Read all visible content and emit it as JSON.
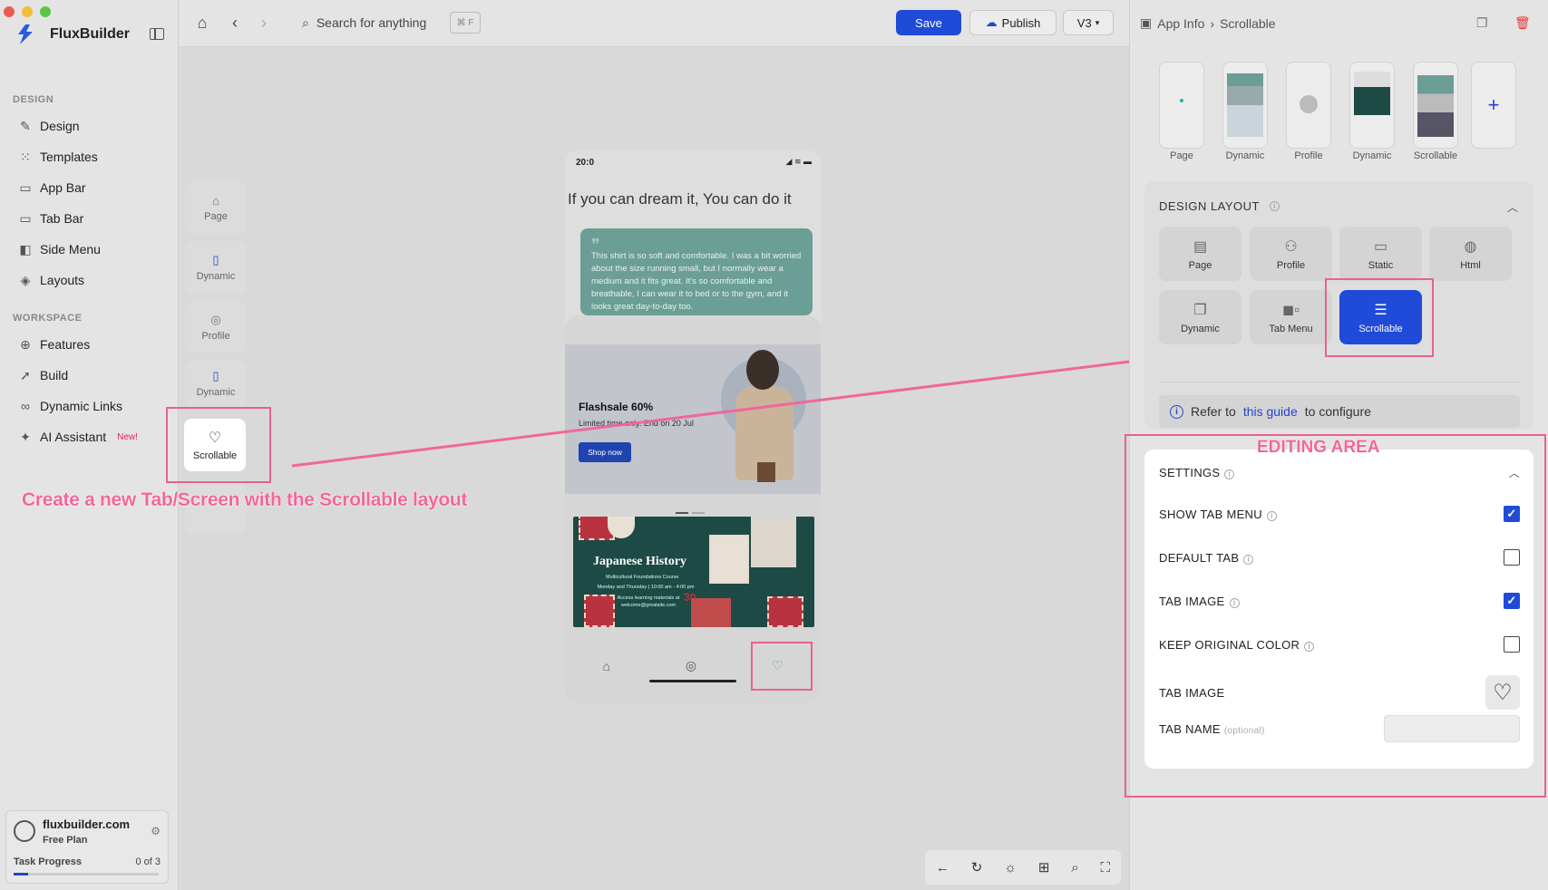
{
  "app": {
    "title": "FluxBuilder"
  },
  "sidebar": {
    "design_label": "DESIGN",
    "design_items": [
      {
        "label": "Design",
        "icon": "pen-icon"
      },
      {
        "label": "Templates",
        "icon": "grid-icon"
      },
      {
        "label": "App Bar",
        "icon": "appbar-icon"
      },
      {
        "label": "Tab Bar",
        "icon": "tabbar-icon"
      },
      {
        "label": "Side Menu",
        "icon": "sidemenu-icon"
      },
      {
        "label": "Layouts",
        "icon": "layers-icon"
      }
    ],
    "workspace_label": "WORKSPACE",
    "workspace_items": [
      {
        "label": "Features",
        "icon": "plus-circle-icon"
      },
      {
        "label": "Build",
        "icon": "rocket-icon"
      },
      {
        "label": "Dynamic Links",
        "icon": "link-icon"
      },
      {
        "label": "AI Assistant",
        "icon": "sparkle-icon",
        "badge": "New!"
      }
    ],
    "card": {
      "domain": "fluxbuilder.com",
      "plan": "Free Plan",
      "task_label": "Task Progress",
      "task_count": "0 of 3",
      "progress": 0.1
    }
  },
  "toolbar": {
    "search_placeholder": "Search for anything",
    "shortcut": "⌘ F",
    "save_label": "Save",
    "publish_label": "Publish",
    "version_label": "V3"
  },
  "canvas": {
    "mini_tabs": [
      {
        "label": "Page",
        "icon": "home-icon"
      },
      {
        "label": "Dynamic",
        "icon": "clipboard-icon"
      },
      {
        "label": "Profile",
        "icon": "profile-icon"
      },
      {
        "label": "Dynamic",
        "icon": "clipboard-icon"
      }
    ],
    "selected_tab": {
      "label": "Scrollable",
      "icon": "heart-icon"
    },
    "annotation": "Create a new Tab/Screen with the Scrollable layout",
    "phone": {
      "time": "20:0",
      "headline": "If you can dream it, You can do it",
      "quote": "This shirt is so soft and comfortable. I was a bit worried about the size running small, but I normally wear a medium and it fits great. It's so comfortable and breathable, I can wear it to bed or to the gym, and it looks great day-to-day too.",
      "banner_title": "Flashsale 60%",
      "banner_sub": "Limited time only. End on 20 Jul",
      "banner_button": "Shop now",
      "history_title": "Japanese History",
      "history_sub": "Multicultural Foundations Course",
      "history_detail": "Monday and Thursday | 10:00 am - 4:00 pm",
      "history_contact": "Access learning materials at welcome@greatsite.com",
      "stamp_numbers": [
        "20",
        "30"
      ]
    }
  },
  "right_panel": {
    "breadcrumb": [
      "App Info",
      "Scrollable"
    ],
    "thumbs": [
      "Page",
      "Dynamic",
      "Profile",
      "Dynamic",
      "Scrollable"
    ],
    "design_layout_title": "DESIGN LAYOUT",
    "layouts": [
      {
        "label": "Page",
        "icon": "page-icon"
      },
      {
        "label": "Profile",
        "icon": "user-icon"
      },
      {
        "label": "Static",
        "icon": "static-icon"
      },
      {
        "label": "Html",
        "icon": "globe-icon"
      },
      {
        "label": "Dynamic",
        "icon": "dynamic-icon"
      },
      {
        "label": "Tab Menu",
        "icon": "tabmenu-icon"
      },
      {
        "label": "Scrollable",
        "icon": "scrollable-icon",
        "selected": true
      }
    ],
    "guide": {
      "prefix": "Refer to",
      "link": "this guide",
      "suffix": "to configure"
    },
    "editing_label": "EDITING AREA",
    "settings_title": "SETTINGS",
    "settings": [
      {
        "label": "SHOW TAB MENU",
        "checked": true
      },
      {
        "label": "DEFAULT TAB",
        "checked": false
      },
      {
        "label": "TAB IMAGE",
        "checked": true
      },
      {
        "label": "KEEP ORIGINAL COLOR",
        "checked": false
      }
    ],
    "tab_image_label": "TAB IMAGE",
    "tab_name_label": "TAB NAME",
    "tab_name_optional": "(optional)",
    "accent": "#1f4bd8",
    "annotation_color": "#e8628f"
  }
}
